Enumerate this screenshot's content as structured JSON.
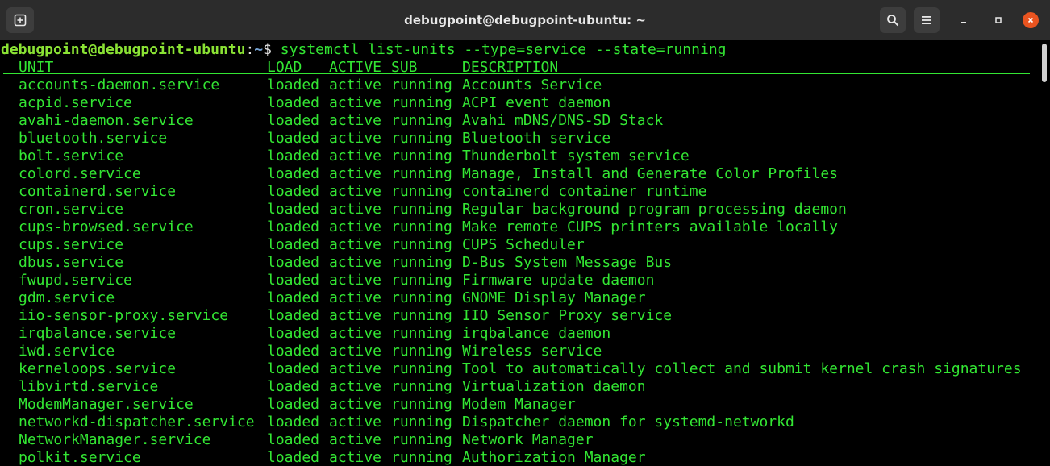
{
  "window": {
    "title": "debugpoint@debugpoint-ubuntu: ~"
  },
  "icons": {
    "new_tab": "new-tab-icon",
    "search": "search-icon",
    "menu": "hamburger-menu-icon",
    "minimize": "minimize-icon",
    "maximize": "maximize-icon",
    "close": "close-icon"
  },
  "colors": {
    "terminal_text": "#33e633",
    "prompt_user": "#8ae234",
    "prompt_path": "#729fcf",
    "close_button": "#e95420",
    "titlebar": "#2c2c2c"
  },
  "prompt": {
    "user_host": "debugpoint@debugpoint-ubuntu",
    "separator": ":",
    "path": "~",
    "symbol": "$",
    "command": " systemctl list-units --type=service --state=running"
  },
  "table": {
    "headers": {
      "unit": "UNIT",
      "load": "LOAD",
      "active": "ACTIVE",
      "sub": "SUB",
      "description": "DESCRIPTION"
    },
    "rows": [
      {
        "unit": "accounts-daemon.service",
        "load": "loaded",
        "active": "active",
        "sub": "running",
        "description": "Accounts Service"
      },
      {
        "unit": "acpid.service",
        "load": "loaded",
        "active": "active",
        "sub": "running",
        "description": "ACPI event daemon"
      },
      {
        "unit": "avahi-daemon.service",
        "load": "loaded",
        "active": "active",
        "sub": "running",
        "description": "Avahi mDNS/DNS-SD Stack"
      },
      {
        "unit": "bluetooth.service",
        "load": "loaded",
        "active": "active",
        "sub": "running",
        "description": "Bluetooth service"
      },
      {
        "unit": "bolt.service",
        "load": "loaded",
        "active": "active",
        "sub": "running",
        "description": "Thunderbolt system service"
      },
      {
        "unit": "colord.service",
        "load": "loaded",
        "active": "active",
        "sub": "running",
        "description": "Manage, Install and Generate Color Profiles"
      },
      {
        "unit": "containerd.service",
        "load": "loaded",
        "active": "active",
        "sub": "running",
        "description": "containerd container runtime"
      },
      {
        "unit": "cron.service",
        "load": "loaded",
        "active": "active",
        "sub": "running",
        "description": "Regular background program processing daemon"
      },
      {
        "unit": "cups-browsed.service",
        "load": "loaded",
        "active": "active",
        "sub": "running",
        "description": "Make remote CUPS printers available locally"
      },
      {
        "unit": "cups.service",
        "load": "loaded",
        "active": "active",
        "sub": "running",
        "description": "CUPS Scheduler"
      },
      {
        "unit": "dbus.service",
        "load": "loaded",
        "active": "active",
        "sub": "running",
        "description": "D-Bus System Message Bus"
      },
      {
        "unit": "fwupd.service",
        "load": "loaded",
        "active": "active",
        "sub": "running",
        "description": "Firmware update daemon"
      },
      {
        "unit": "gdm.service",
        "load": "loaded",
        "active": "active",
        "sub": "running",
        "description": "GNOME Display Manager"
      },
      {
        "unit": "iio-sensor-proxy.service",
        "load": "loaded",
        "active": "active",
        "sub": "running",
        "description": "IIO Sensor Proxy service"
      },
      {
        "unit": "irqbalance.service",
        "load": "loaded",
        "active": "active",
        "sub": "running",
        "description": "irqbalance daemon"
      },
      {
        "unit": "iwd.service",
        "load": "loaded",
        "active": "active",
        "sub": "running",
        "description": "Wireless service"
      },
      {
        "unit": "kerneloops.service",
        "load": "loaded",
        "active": "active",
        "sub": "running",
        "description": "Tool to automatically collect and submit kernel crash signatures"
      },
      {
        "unit": "libvirtd.service",
        "load": "loaded",
        "active": "active",
        "sub": "running",
        "description": "Virtualization daemon"
      },
      {
        "unit": "ModemManager.service",
        "load": "loaded",
        "active": "active",
        "sub": "running",
        "description": "Modem Manager"
      },
      {
        "unit": "networkd-dispatcher.service",
        "load": "loaded",
        "active": "active",
        "sub": "running",
        "description": "Dispatcher daemon for systemd-networkd"
      },
      {
        "unit": "NetworkManager.service",
        "load": "loaded",
        "active": "active",
        "sub": "running",
        "description": "Network Manager"
      },
      {
        "unit": "polkit.service",
        "load": "loaded",
        "active": "active",
        "sub": "running",
        "description": "Authorization Manager"
      }
    ]
  }
}
